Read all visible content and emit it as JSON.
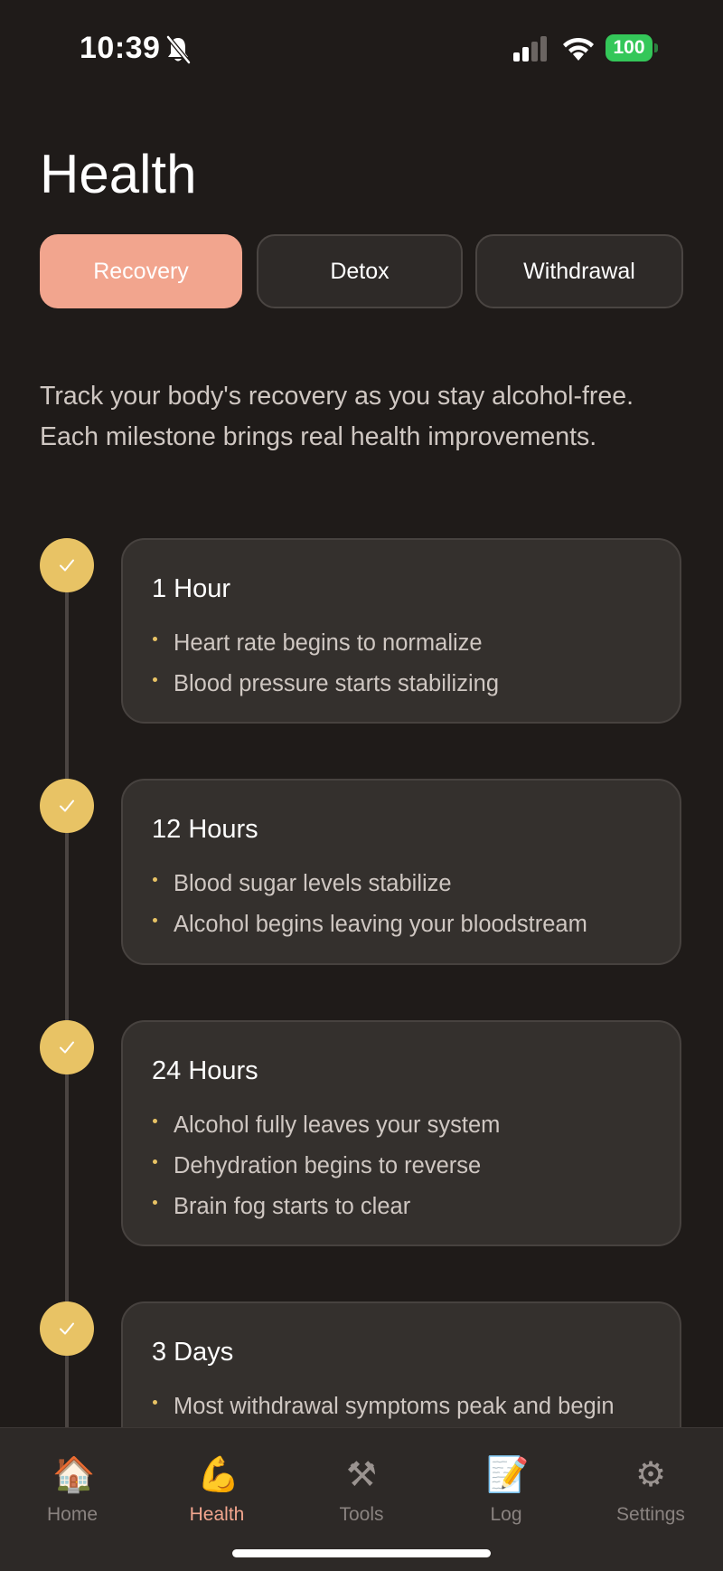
{
  "status_bar": {
    "time": "10:39",
    "battery": "100",
    "icons": [
      "bell-slash-icon",
      "signal-icon",
      "wifi-icon",
      "battery-icon"
    ]
  },
  "header": {
    "title": "Health"
  },
  "tabs": [
    {
      "label": "Recovery",
      "active": true
    },
    {
      "label": "Detox",
      "active": false
    },
    {
      "label": "Withdrawal",
      "active": false
    }
  ],
  "intro": "Track your body's recovery as you stay alcohol-free. Each milestone brings real health improvements.",
  "milestones": [
    {
      "title": "1 Hour",
      "completed": true,
      "items": [
        "Heart rate begins to normalize",
        "Blood pressure starts stabilizing"
      ]
    },
    {
      "title": "12 Hours",
      "completed": true,
      "items": [
        "Blood sugar levels stabilize",
        "Alcohol begins leaving your bloodstream"
      ]
    },
    {
      "title": "24 Hours",
      "completed": true,
      "items": [
        "Alcohol fully leaves your system",
        "Dehydration begins to reverse",
        "Brain fog starts to clear"
      ]
    },
    {
      "title": "3 Days",
      "completed": true,
      "items": [
        "Most withdrawal symptoms peak and begin"
      ]
    }
  ],
  "tabbar": [
    {
      "label": "Home",
      "icon": "🏠",
      "icon_name": "house-icon",
      "active": false
    },
    {
      "label": "Health",
      "icon": "💪",
      "icon_name": "flexed-biceps-icon",
      "active": true
    },
    {
      "label": "Tools",
      "icon": "⚒",
      "icon_name": "hammer-pick-icon",
      "active": false
    },
    {
      "label": "Log",
      "icon": "📝",
      "icon_name": "memo-icon",
      "active": false
    },
    {
      "label": "Settings",
      "icon": "⚙",
      "icon_name": "gear-icon",
      "active": false
    }
  ],
  "colors": {
    "background": "#1f1b19",
    "accent": "#f2a58e",
    "milestone": "#e8c365",
    "card": "#34302d",
    "battery": "#34c759"
  }
}
